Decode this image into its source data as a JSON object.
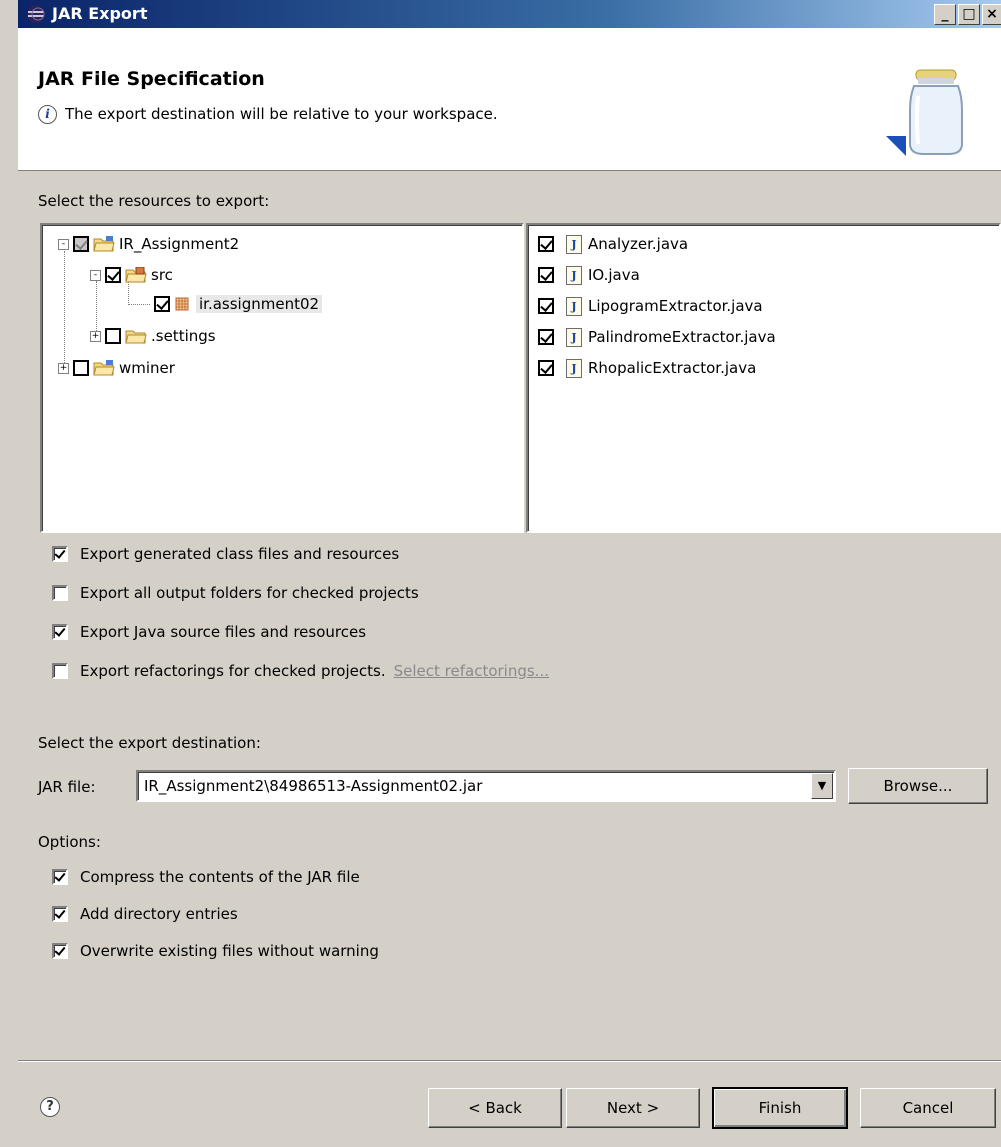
{
  "window": {
    "title": "JAR Export",
    "header_title": "JAR File Specification",
    "header_message": "The export destination will be relative to your workspace."
  },
  "resources": {
    "label": "Select the resources to export:",
    "tree": [
      {
        "label": "IR_Assignment2",
        "checked": true,
        "grayed": true,
        "expander": "-"
      },
      {
        "label": "src",
        "checked": true,
        "expander": "-"
      },
      {
        "label": "ir.assignment02",
        "checked": true,
        "selected": true
      },
      {
        "label": ".settings",
        "checked": false,
        "expander": "+"
      },
      {
        "label": "wminer",
        "checked": false,
        "expander": "+"
      }
    ],
    "files": [
      {
        "label": "Analyzer.java",
        "checked": true
      },
      {
        "label": "IO.java",
        "checked": true
      },
      {
        "label": "LipogramExtractor.java",
        "checked": true
      },
      {
        "label": "PalindromeExtractor.java",
        "checked": true
      },
      {
        "label": "RhopalicExtractor.java",
        "checked": true
      }
    ]
  },
  "export_options": [
    {
      "label": "Export generated class files and resources",
      "checked": true
    },
    {
      "label": "Export all output folders for checked projects",
      "checked": false
    },
    {
      "label": "Export Java source files and resources",
      "checked": true
    },
    {
      "label": "Export refactorings for checked projects.",
      "checked": false,
      "link": "Select refactorings..."
    }
  ],
  "destination": {
    "label": "Select the export destination:",
    "jar_label": "JAR file:",
    "jar_value": "IR_Assignment2\\84986513-Assignment02.jar",
    "browse_label": "Browse..."
  },
  "options": {
    "label": "Options:",
    "items": [
      {
        "label": "Compress the contents of the JAR file",
        "checked": true
      },
      {
        "label": "Add directory entries",
        "checked": true
      },
      {
        "label": "Overwrite existing files without warning",
        "checked": true
      }
    ]
  },
  "buttons": {
    "help": "?",
    "back": "< Back",
    "next": "Next >",
    "finish": "Finish",
    "cancel": "Cancel"
  },
  "icons": {
    "title": "eclipse-icon",
    "info": "info-icon",
    "jar": "jar-icon",
    "folder": "folder-icon",
    "package": "package-icon",
    "java": "java-file-icon",
    "help": "help-icon"
  }
}
